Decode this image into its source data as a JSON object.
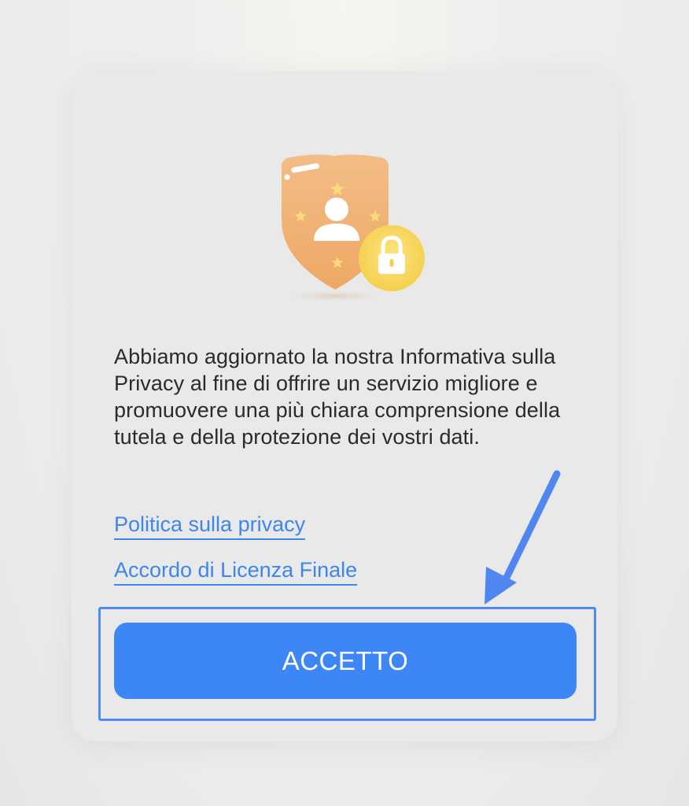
{
  "dialog": {
    "message": "Abbiamo aggiornato la nostra Informativa sulla Privacy al fine di offrire un servizio migliore e promuovere una più chiara comprensione della tutela e della protezione dei vostri dati.",
    "links": {
      "privacy_policy": "Politica sulla privacy",
      "eula": "Accordo di Licenza Finale"
    },
    "accept_button": "ACCETTO"
  },
  "icons": {
    "illustration": "shield-user-lock-icon",
    "annotation_arrow": "arrow-down-left-icon"
  },
  "colors": {
    "accent": "#3d86f5",
    "link": "#3d86f0",
    "shield": "#f0b070",
    "lock_badge": "#f7d860",
    "highlight": "#4f8bf5"
  }
}
